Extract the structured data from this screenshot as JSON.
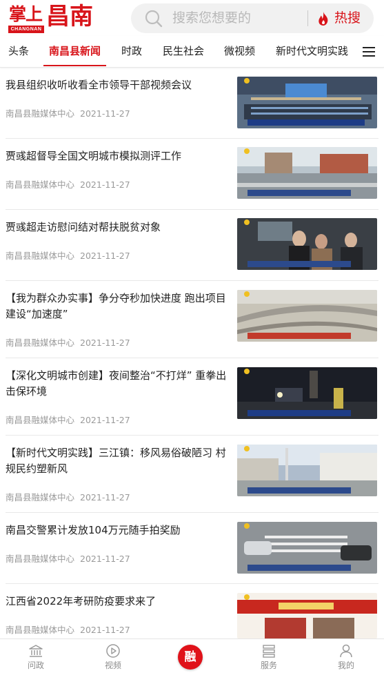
{
  "header": {
    "logo_small": "掌上",
    "logo_big": "昌南",
    "logo_en": "CHANGNAN",
    "search_placeholder": "搜索您想要的",
    "hot_label": "热搜",
    "accent_color": "#d8141a"
  },
  "tabs": [
    {
      "label": "头条",
      "active": false
    },
    {
      "label": "南昌县新闻",
      "active": true
    },
    {
      "label": "时政",
      "active": false
    },
    {
      "label": "民生社会",
      "active": false
    },
    {
      "label": "微视频",
      "active": false
    },
    {
      "label": "新时代文明实践",
      "active": false
    }
  ],
  "news": [
    {
      "title": "我县组织收听收看全市领导干部视频会议",
      "source": "南昌县融媒体中心",
      "date": "2021-11-27",
      "thumb_icon": "meeting-photo"
    },
    {
      "title": "贾彧超督导全国文明城市模拟测评工作",
      "source": "南昌县融媒体中心",
      "date": "2021-11-27",
      "thumb_icon": "street-photo"
    },
    {
      "title": "贾彧超走访慰问结对帮扶脱贫对象",
      "source": "南昌县融媒体中心",
      "date": "2021-11-27",
      "thumb_icon": "visit-photo"
    },
    {
      "title": "【我为群众办实事】争分夺秒加快进度 跑出项目建设“加速度”",
      "source": "南昌县融媒体中心",
      "date": "2021-11-27",
      "thumb_icon": "construction-photo"
    },
    {
      "title": "【深化文明城市创建】夜间整治“不打烊” 重拳出击保环境",
      "source": "南昌县融媒体中心",
      "date": "2021-11-27",
      "thumb_icon": "night-street-photo"
    },
    {
      "title": "【新时代文明实践】三江镇：移风易俗破陋习 村规民约塑新风",
      "source": "南昌县融媒体中心",
      "date": "2021-11-27",
      "thumb_icon": "village-photo"
    },
    {
      "title": "南昌交警累计发放104万元随手拍奖励",
      "source": "南昌县融媒体中心",
      "date": "2021-11-27",
      "thumb_icon": "traffic-photo"
    },
    {
      "title": "江西省2022年考研防疫要求来了",
      "source": "南昌县融媒体中心",
      "date": "2021-11-27",
      "thumb_icon": "notice-photo"
    }
  ],
  "bottom_nav": [
    {
      "label": "问政",
      "icon": "bank-icon"
    },
    {
      "label": "视频",
      "icon": "play-icon"
    },
    {
      "label": "融",
      "icon": "center-button"
    },
    {
      "label": "服务",
      "icon": "service-icon"
    },
    {
      "label": "我的",
      "icon": "user-icon"
    }
  ]
}
